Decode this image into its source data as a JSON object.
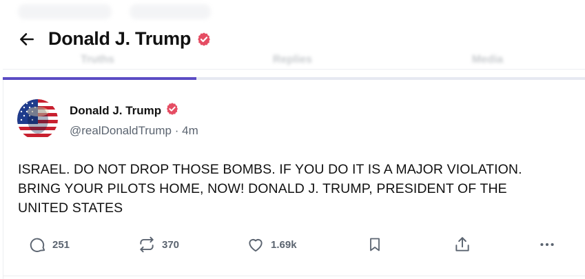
{
  "header": {
    "title": "Donald J. Trump",
    "tabs": [
      {
        "label": "Truths"
      },
      {
        "label": "Replies"
      },
      {
        "label": "Media"
      }
    ]
  },
  "post": {
    "author_name": "Donald J. Trump",
    "handle": "@realDonaldTrump",
    "separator": "·",
    "time": "4m",
    "text": "ISRAEL. DO NOT DROP THOSE BOMBS. IF YOU DO IT IS A MAJOR VIOLATION. BRING YOUR PILOTS HOME, NOW!  DONALD J. TRUMP, PRESIDENT OF THE UNITED STATES",
    "actions": {
      "replies": "251",
      "retruths": "370",
      "likes": "1.69k"
    }
  },
  "icons": {
    "back": "arrow-left-icon",
    "verified": "verified-badge-icon",
    "reply": "comment-bubble-icon",
    "retruth": "repost-arrows-icon",
    "like": "heart-icon",
    "bookmark": "bookmark-icon",
    "share": "share-upload-icon",
    "more": "more-dots-icon"
  },
  "colors": {
    "accent": "#5b4cc4",
    "verified": "#e54d63",
    "muted": "#5b6470"
  }
}
